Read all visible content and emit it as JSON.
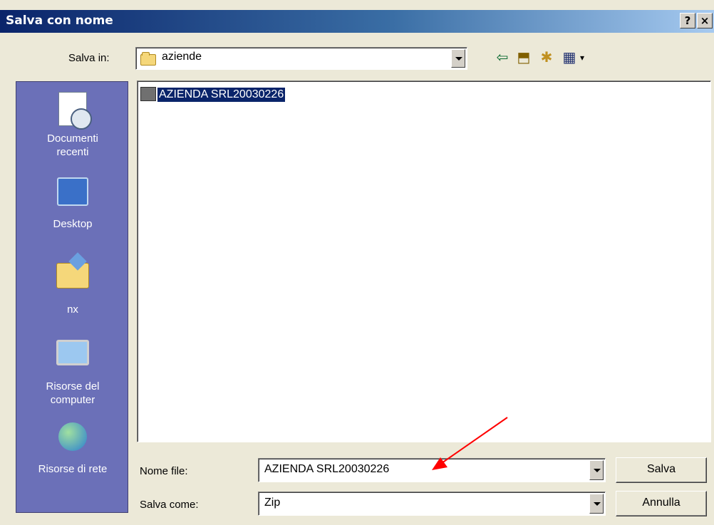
{
  "window": {
    "title": "Salva con nome",
    "help_label": "?",
    "close_label": "×"
  },
  "toolbar": {
    "save_in_label": "Salva in:",
    "save_in_value": "aziende",
    "back_icon": "back-arrow-icon",
    "up_icon": "up-folder-icon",
    "new_folder_icon": "new-folder-icon",
    "view_icon": "view-menu-icon"
  },
  "places": [
    {
      "label": "Documenti recenti",
      "icon": "recent-documents-icon"
    },
    {
      "label": "Desktop",
      "icon": "desktop-icon"
    },
    {
      "label": "nx",
      "icon": "user-folder-icon"
    },
    {
      "label": "Risorse del computer",
      "icon": "my-computer-icon"
    },
    {
      "label": "Risorse di rete",
      "icon": "network-places-icon"
    }
  ],
  "files": [
    {
      "name": "AZIENDA SRL20030226",
      "selected": true
    }
  ],
  "form": {
    "filename_label": "Nome file:",
    "filename_value": "AZIENDA SRL20030226",
    "filetype_label": "Salva come:",
    "filetype_value": "Zip"
  },
  "buttons": {
    "save": "Salva",
    "cancel": "Annulla"
  },
  "colors": {
    "titlebar": "#0a246a",
    "places_bg": "#6b70b8",
    "selection": "#0a246a",
    "annotation_arrow": "#ff0000"
  }
}
